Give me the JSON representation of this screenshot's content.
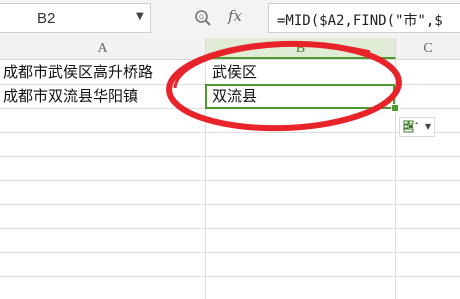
{
  "formula_bar": {
    "name_box": "B2",
    "fx_label": "fx",
    "formula": "=MID($A2,FIND(\"市\",$"
  },
  "columns": [
    "A",
    "B",
    "C"
  ],
  "rows": [
    {
      "a": "成都市武侯区高升桥路",
      "b": "武侯区"
    },
    {
      "a": "成都市双流县华阳镇",
      "b": "双流县"
    }
  ],
  "colors": {
    "selection": "#4e9a2e",
    "annotation": "#e8232a"
  },
  "icons": {
    "name_box_dropdown": "chevron-down-icon",
    "zoom": "zoom-icon",
    "paste_options": "paste-options-icon"
  }
}
